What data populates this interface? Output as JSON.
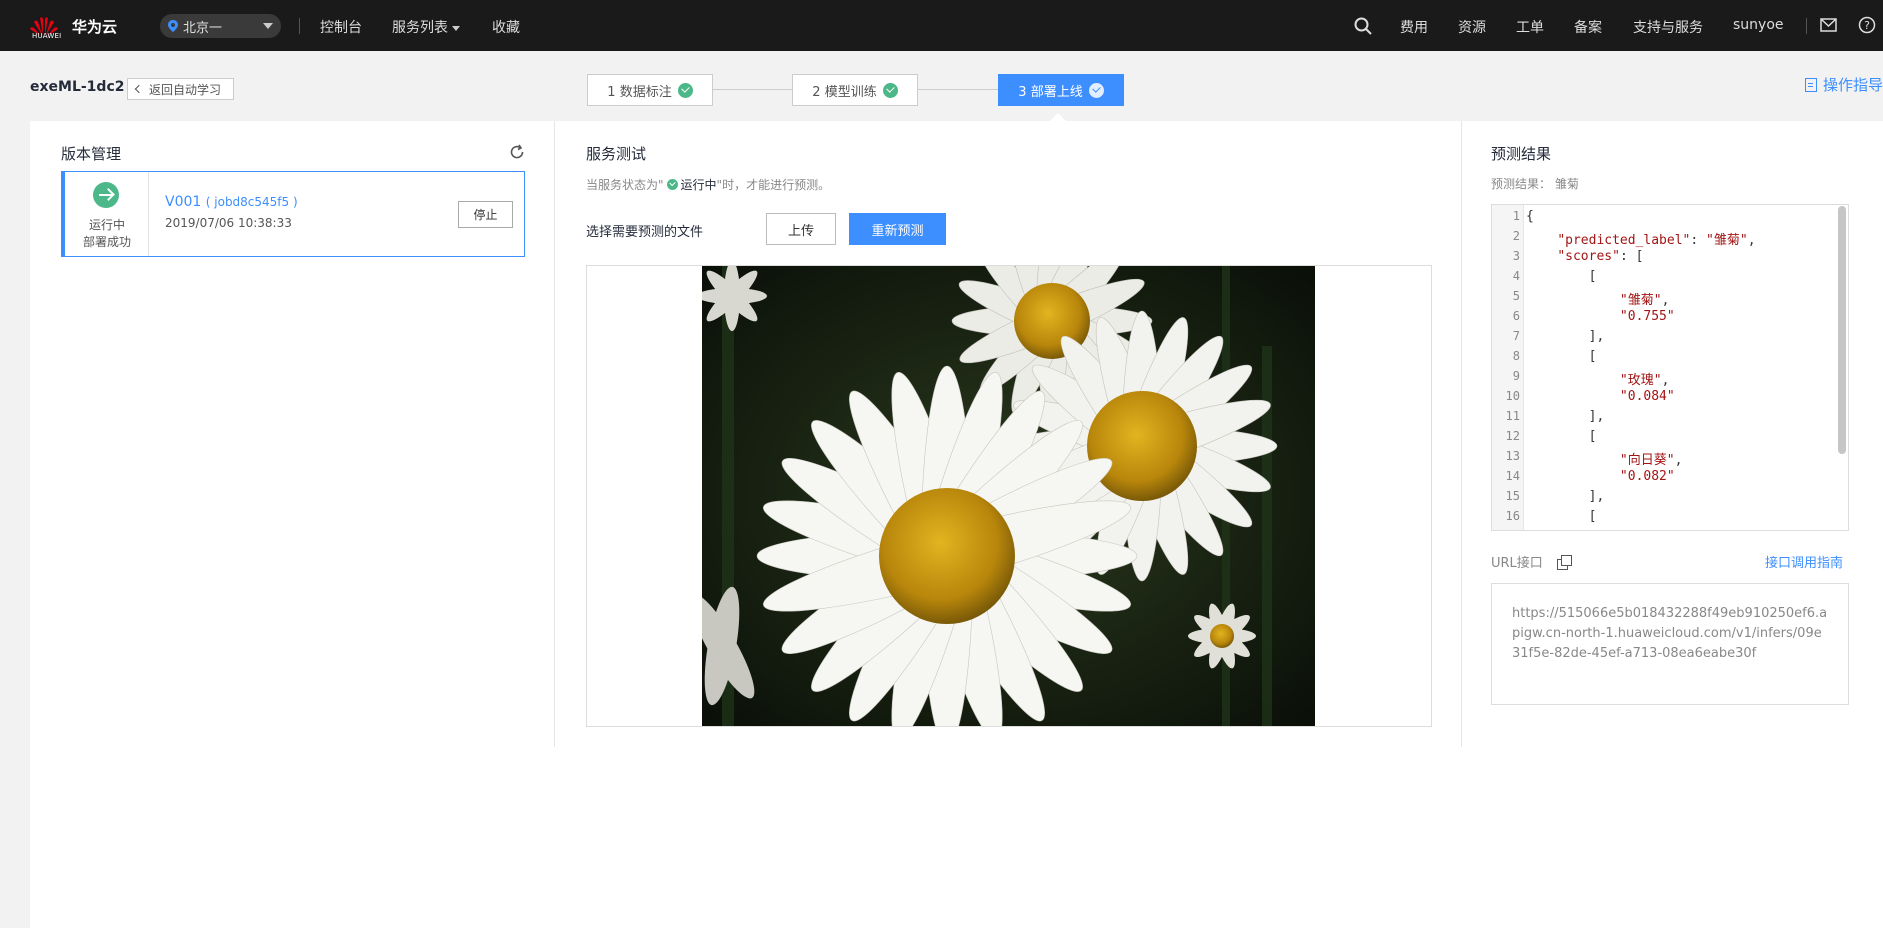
{
  "topbar": {
    "logo_text": "HUAWEI",
    "brand": "华为云",
    "region": "北京一",
    "nav": [
      "控制台",
      "服务列表",
      "收藏"
    ],
    "right": [
      "费用",
      "资源",
      "工单",
      "备案",
      "支持与服务"
    ],
    "user": "sunyoe"
  },
  "subbar": {
    "project": "exeML-1dc2",
    "back": "返回自动学习",
    "steps": [
      "1 数据标注",
      "2 模型训练",
      "3 部署上线"
    ],
    "guide": "操作指导"
  },
  "versions": {
    "title": "版本管理",
    "card": {
      "status1": "运行中",
      "status2": "部署成功",
      "version": "V001",
      "job": "( jobd8c545f5 )",
      "time": "2019/07/06 10:38:33",
      "stop": "停止"
    }
  },
  "test": {
    "title": "服务测试",
    "hint_prefix": "当服务状态为\"",
    "hint_status": "运行中",
    "hint_suffix": "\"时，才能进行预测。",
    "file_label": "选择需要预测的文件",
    "upload": "上传",
    "repredict": "重新预测"
  },
  "result": {
    "title": "预测结果",
    "sub": "预测结果：  雏菊",
    "lines": [
      {
        "n": "1",
        "t": "{"
      },
      {
        "n": "2",
        "t": "    \"predicted_label\": \"雏菊\","
      },
      {
        "n": "3",
        "t": "    \"scores\": ["
      },
      {
        "n": "4",
        "t": "        ["
      },
      {
        "n": "5",
        "t": "            \"雏菊\","
      },
      {
        "n": "6",
        "t": "            \"0.755\""
      },
      {
        "n": "7",
        "t": "        ],"
      },
      {
        "n": "8",
        "t": "        ["
      },
      {
        "n": "9",
        "t": "            \"玫瑰\","
      },
      {
        "n": "10",
        "t": "            \"0.084\""
      },
      {
        "n": "11",
        "t": "        ],"
      },
      {
        "n": "12",
        "t": "        ["
      },
      {
        "n": "13",
        "t": "            \"向日葵\","
      },
      {
        "n": "14",
        "t": "            \"0.082\""
      },
      {
        "n": "15",
        "t": "        ],"
      },
      {
        "n": "16",
        "t": "        ["
      }
    ],
    "url_label": "URL接口",
    "api_guide": "接口调用指南",
    "url": "https://515066e5b018432288f49eb910250ef6.apigw.cn-north-1.huaweicloud.com/v1/infers/09e31f5e-82de-45ef-a713-08ea6eabe30f"
  },
  "colors": {
    "accent": "#3d8eff",
    "success": "#4cb88a",
    "topbar": "#1a1a1a",
    "json_string": "#a31515"
  }
}
